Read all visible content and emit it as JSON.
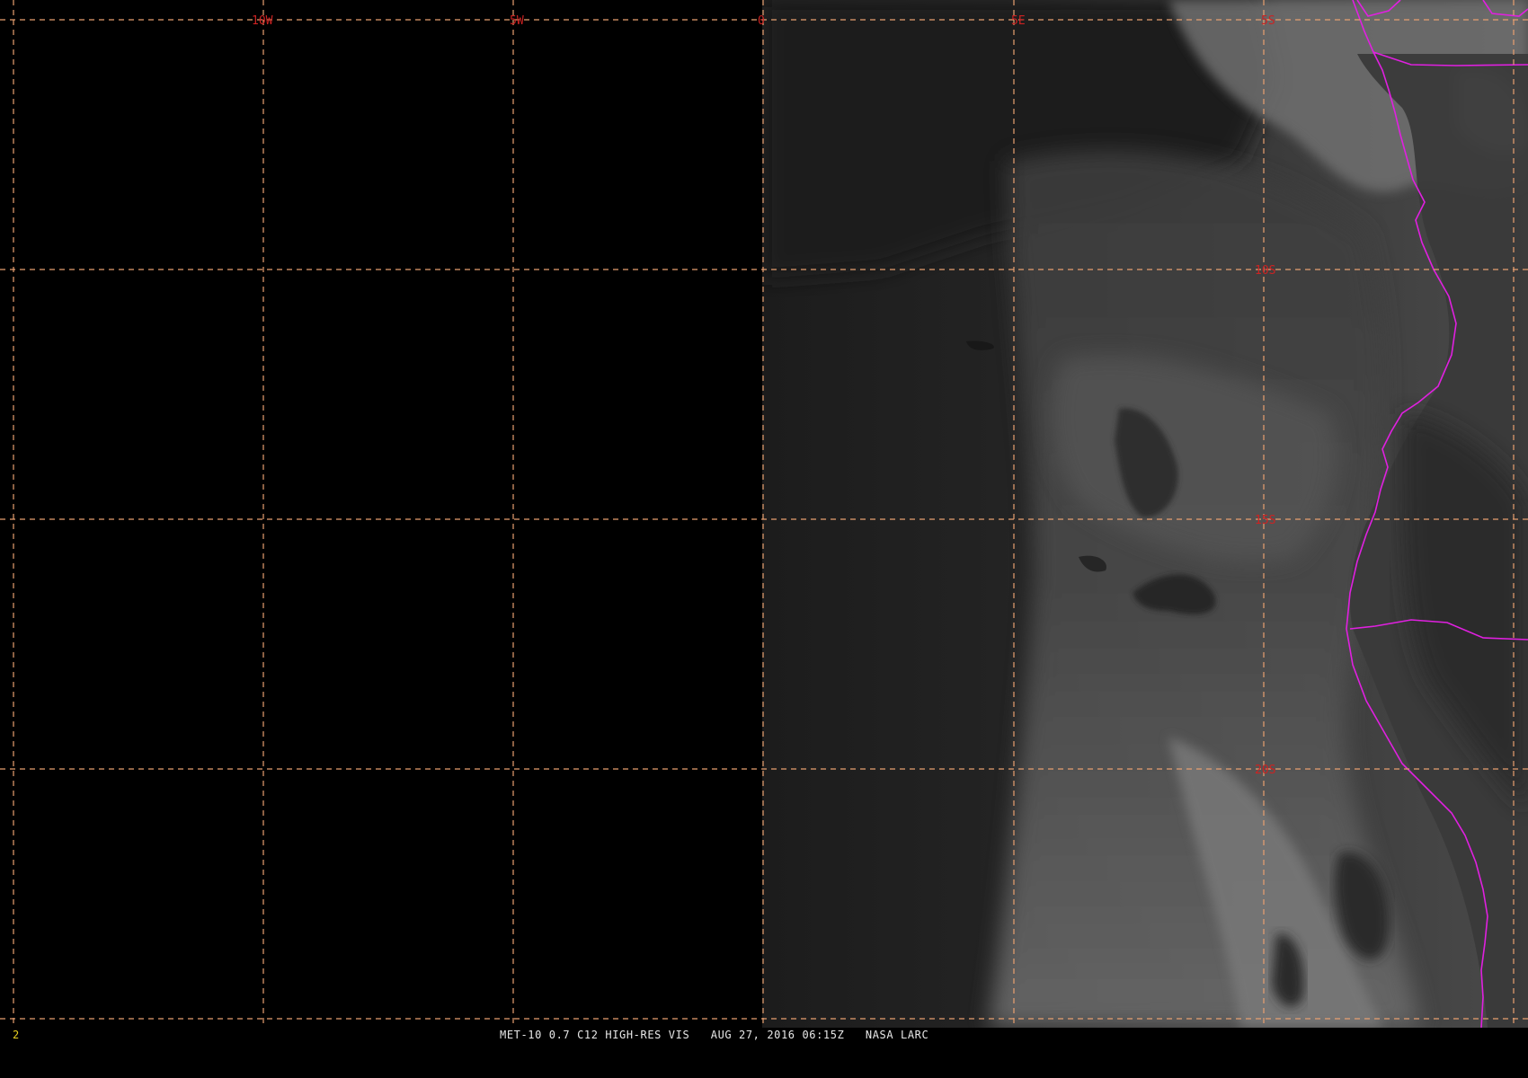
{
  "imagery": {
    "satellite": "MET-10",
    "product": "0.7 C12 HIGH-RES VIS",
    "caption": "MET-10 0.7 C12 HIGH-RES VIS   AUG 27, 2016 06:15Z   NASA LARC",
    "frame_number": "2"
  },
  "grid": {
    "longitude_labels": [
      "10W",
      "5W",
      "0",
      "5E",
      "5S"
    ],
    "latitude_labels": [
      "10S",
      "15S",
      "20S"
    ]
  },
  "colors": {
    "background": "#000000",
    "gridline": "#e8a070",
    "grid_label": "#cc2222",
    "political_border": "#e020e0",
    "caption_text": "#e8e8e8",
    "frame_number": "#e8d020"
  }
}
